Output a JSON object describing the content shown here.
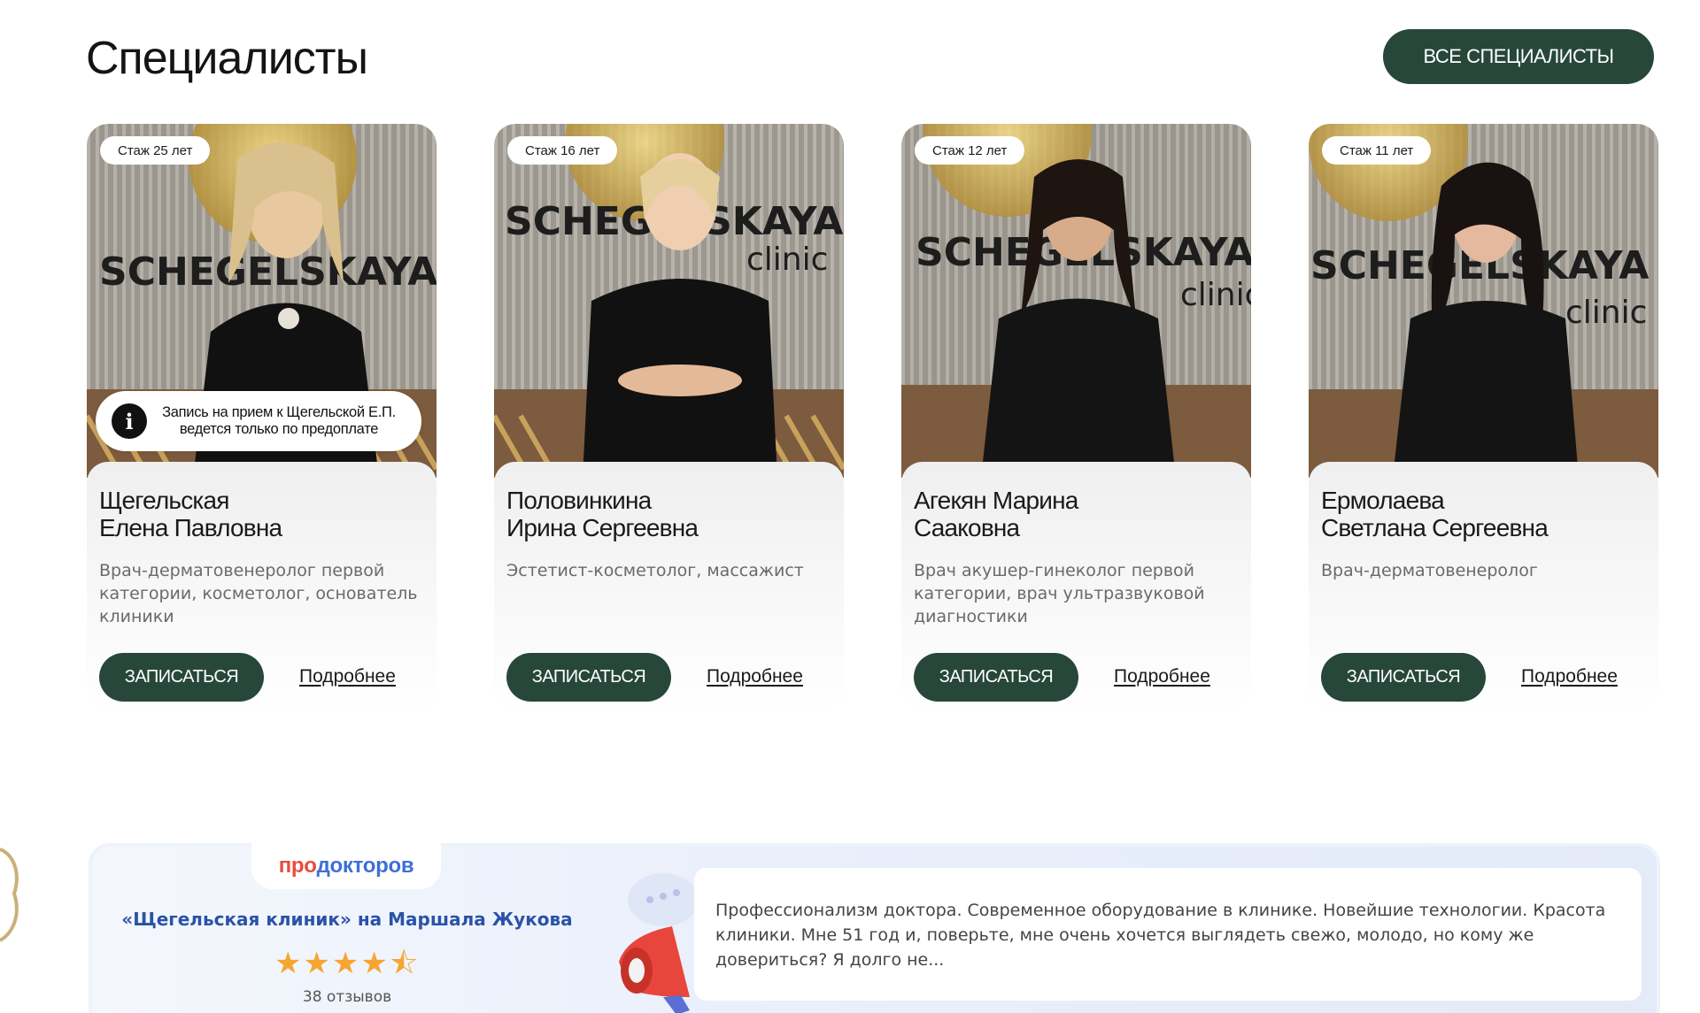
{
  "header": {
    "title": "Специалисты",
    "all_button": "ВСЕ СПЕЦИАЛИСТЫ"
  },
  "colors": {
    "accent": "#27473a",
    "prodoctorov_red": "#e84c3d",
    "prodoctorov_blue": "#3d6fd6",
    "star": "#f6a531"
  },
  "specialists": [
    {
      "experience": "Стаж 25 лет",
      "name_line1": "Щегельская",
      "name_line2": "Елена Павловна",
      "specialty": "Врач-дерматовенеролог первой категории, косметолог, основатель клиники",
      "notice_line1": "Запись на прием к Щегельской Е.П.",
      "notice_line2": "ведется только по предоплате",
      "book_label": "ЗАПИСАТЬСЯ",
      "more_label": "Подробнее"
    },
    {
      "experience": "Стаж 16 лет",
      "name_line1": "Половинкина",
      "name_line2": "Ирина Сергеевна",
      "specialty": "Эстетист-косметолог, массажист",
      "book_label": "ЗАПИСАТЬСЯ",
      "more_label": "Подробнее"
    },
    {
      "experience": "Стаж 12 лет",
      "name_line1": "Агекян Марина",
      "name_line2": "Сааковна",
      "specialty": "Врач акушер-гинеколог первой категории, врач ультразвуковой диагностики",
      "book_label": "ЗАПИСАТЬСЯ",
      "more_label": "Подробнее"
    },
    {
      "experience": "Стаж 11 лет",
      "name_line1": "Ермолаева",
      "name_line2": "Светлана Сергеевна",
      "specialty": "Врач-дерматовенеролог",
      "book_label": "ЗАПИСАТЬСЯ",
      "more_label": "Подробнее"
    }
  ],
  "photo_backdrop": {
    "brand_text": "SCHEGELSKAYA",
    "brand_sub": "clinic"
  },
  "review_widget": {
    "logo_part1": "про",
    "logo_part2": "докторов",
    "clinic": "«Щегельская клиник» на Маршала Жукова",
    "rating": 4.5,
    "stars_display": "★★★★⯪",
    "reviews_count": "38 отзывов",
    "quote": "Профессионализм доктора. Современное оборудование в клинике. Новейшие технологии. Красота клиники. Мне 51 год и, поверьте, мне очень хочется выглядеть свежо, молодо, но кому же довериться? Я долго не..."
  }
}
